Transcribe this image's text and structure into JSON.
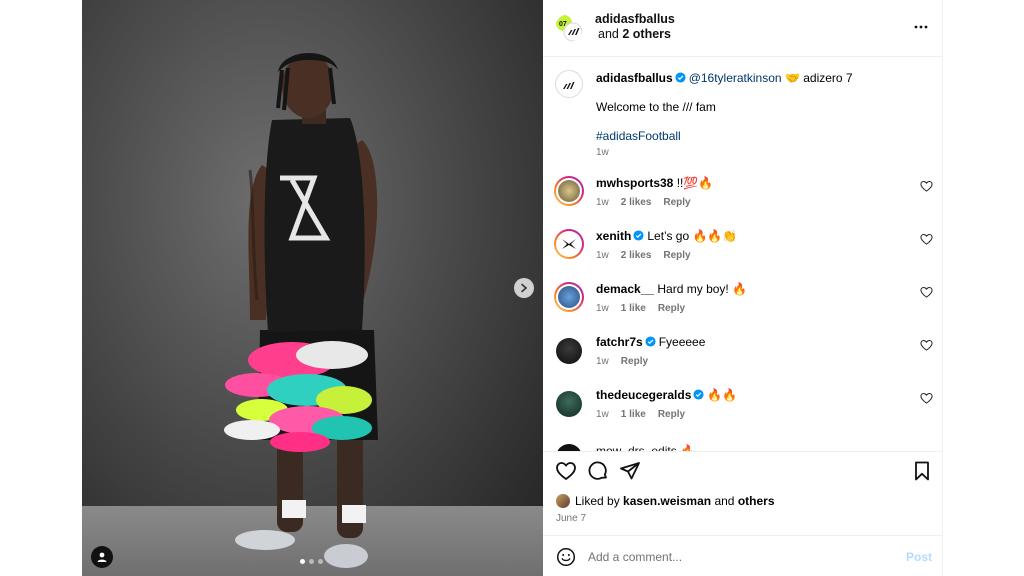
{
  "header": {
    "username": "adidasfballus",
    "others_prefix": "and",
    "others": "2 others",
    "more_icon": "more-horizontal-icon"
  },
  "caption": {
    "username": "adidasfballus",
    "mention": "@16tyleratkinson",
    "emoji": "🤝",
    "rest": " adizero 7",
    "line2": "Welcome to the /// fam",
    "hashtag": "#adidasFootball",
    "time": "1w"
  },
  "comments": [
    {
      "username": "mwhsports38",
      "verified": false,
      "text": "!!💯🔥",
      "time": "1w",
      "likes": "2 likes",
      "reply": "Reply"
    },
    {
      "username": "xenith",
      "verified": true,
      "text": "Let’s go 🔥🔥👏",
      "time": "1w",
      "likes": "2 likes",
      "reply": "Reply"
    },
    {
      "username": "demack__",
      "verified": false,
      "text": "Hard my boy! 🔥",
      "time": "1w",
      "likes": "1 like",
      "reply": "Reply"
    },
    {
      "username": "fatchr7s",
      "verified": true,
      "text": "Fyeeeee",
      "time": "1w",
      "likes": "",
      "reply": "Reply"
    },
    {
      "username": "thedeucegeralds",
      "verified": true,
      "text": "🔥🔥",
      "time": "1w",
      "likes": "1 like",
      "reply": "Reply"
    }
  ],
  "partial_comment": "mow_drs_edits 🔥",
  "liked_by": {
    "prefix": "Liked by",
    "user": "kasen.weisman",
    "and": "and",
    "others": "others"
  },
  "date": "June 7",
  "add_comment": {
    "placeholder": "Add a comment...",
    "post_label": "Post"
  },
  "colors": {
    "link": "#00376b",
    "verified": "#0095f6",
    "post_disabled": "#b3dbff"
  }
}
